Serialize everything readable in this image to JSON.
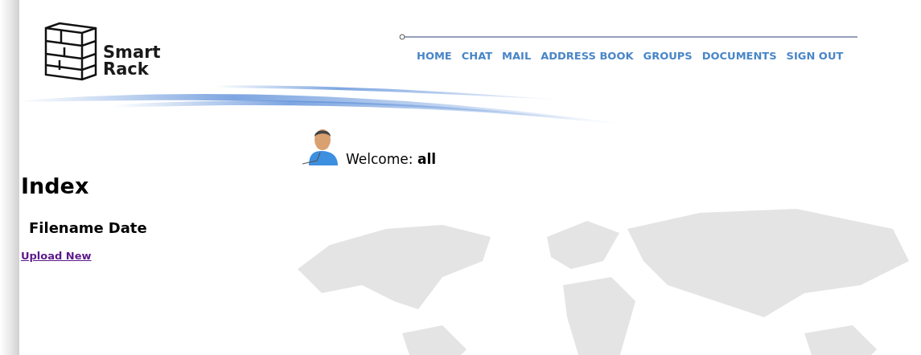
{
  "logo": {
    "line_1": "Smart",
    "line_2": "Rack"
  },
  "nav": [
    {
      "label": "HOME"
    },
    {
      "label": "CHAT"
    },
    {
      "label": "MAIL"
    },
    {
      "label": "ADDRESS BOOK"
    },
    {
      "label": "GROUPS"
    },
    {
      "label": "DOCUMENTS"
    },
    {
      "label": "SIGN OUT"
    }
  ],
  "welcome": "Welcome: **all**",
  "page_title": "Index",
  "table": {
    "columns": [
      "Filename",
      "Date"
    ]
  },
  "upload_link": "Upload New"
}
